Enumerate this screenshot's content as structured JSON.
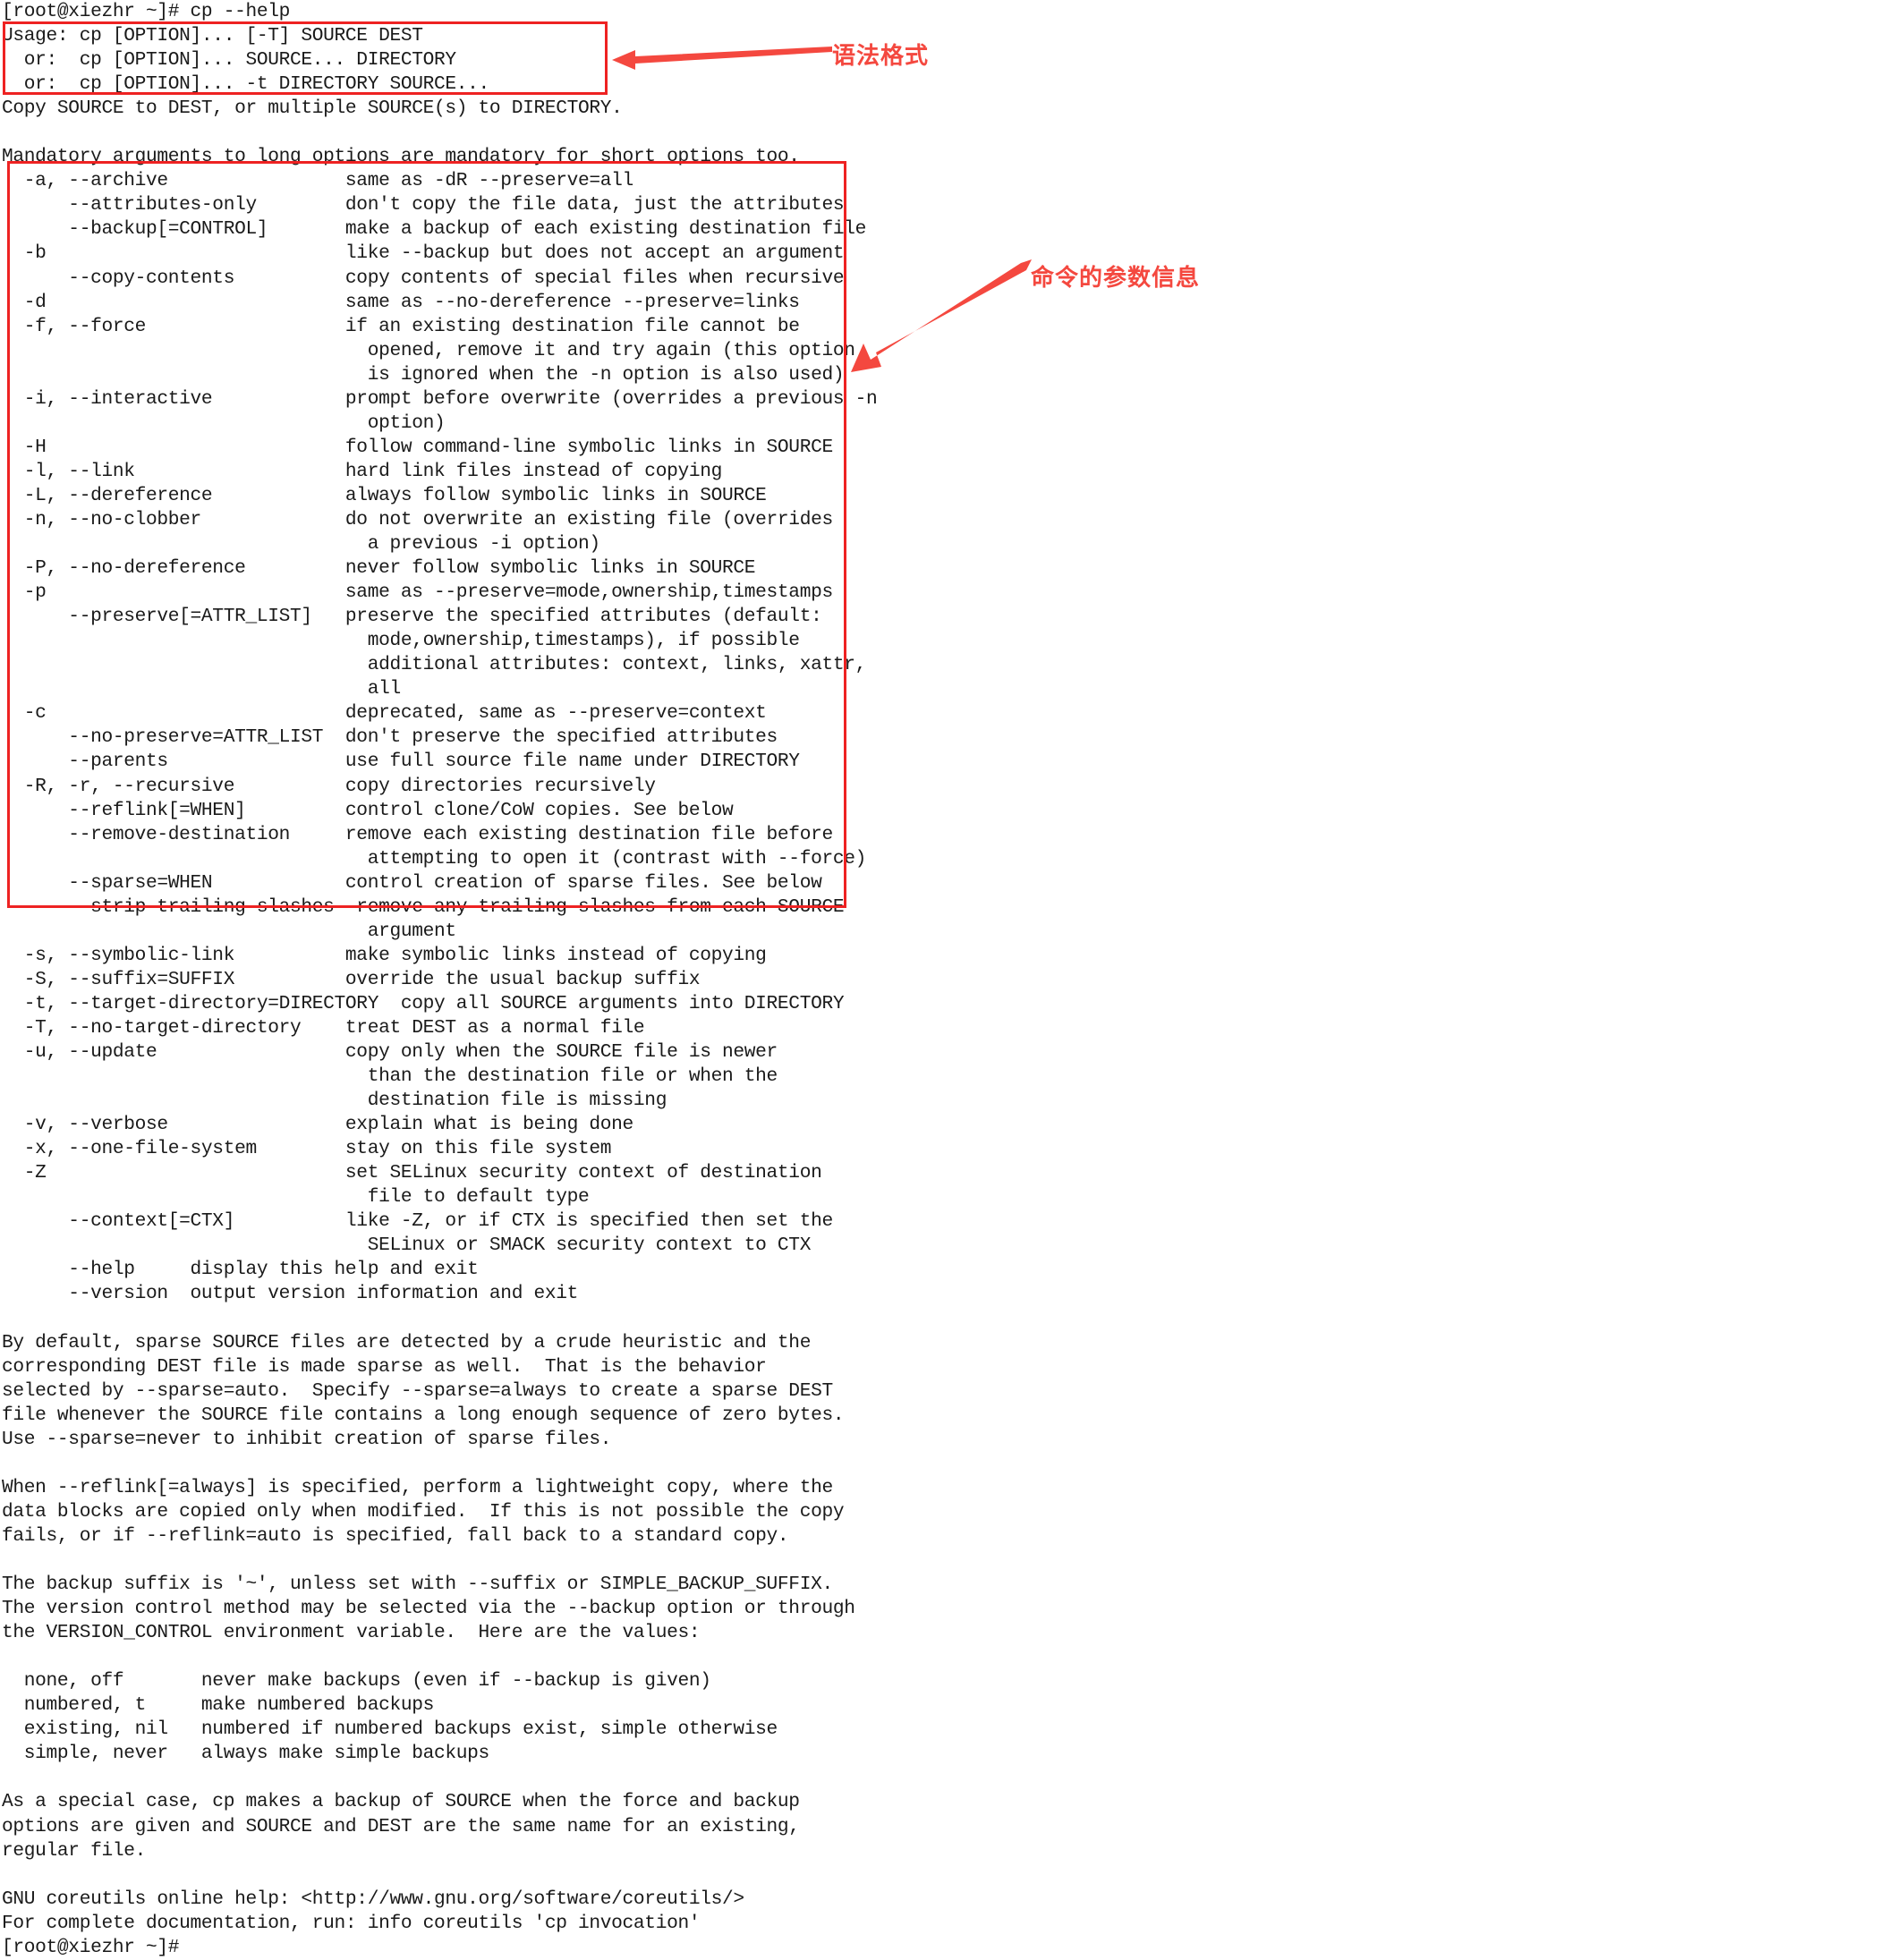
{
  "terminal": {
    "prompt": "[root@xiezhr ~]#",
    "command": "cp --help",
    "lines": [
      "[root@xiezhr ~]# cp --help",
      "Usage: cp [OPTION]... [-T] SOURCE DEST",
      "  or:  cp [OPTION]... SOURCE... DIRECTORY",
      "  or:  cp [OPTION]... -t DIRECTORY SOURCE...",
      "Copy SOURCE to DEST, or multiple SOURCE(s) to DIRECTORY.",
      "",
      "Mandatory arguments to long options are mandatory for short options too.",
      "  -a, --archive                same as -dR --preserve=all",
      "      --attributes-only        don't copy the file data, just the attributes",
      "      --backup[=CONTROL]       make a backup of each existing destination file",
      "  -b                           like --backup but does not accept an argument",
      "      --copy-contents          copy contents of special files when recursive",
      "  -d                           same as --no-dereference --preserve=links",
      "  -f, --force                  if an existing destination file cannot be",
      "                                 opened, remove it and try again (this option",
      "                                 is ignored when the -n option is also used)",
      "  -i, --interactive            prompt before overwrite (overrides a previous -n",
      "                                 option)",
      "  -H                           follow command-line symbolic links in SOURCE",
      "  -l, --link                   hard link files instead of copying",
      "  -L, --dereference            always follow symbolic links in SOURCE",
      "  -n, --no-clobber             do not overwrite an existing file (overrides",
      "                                 a previous -i option)",
      "  -P, --no-dereference         never follow symbolic links in SOURCE",
      "  -p                           same as --preserve=mode,ownership,timestamps",
      "      --preserve[=ATTR_LIST]   preserve the specified attributes (default:",
      "                                 mode,ownership,timestamps), if possible",
      "                                 additional attributes: context, links, xattr,",
      "                                 all",
      "  -c                           deprecated, same as --preserve=context",
      "      --no-preserve=ATTR_LIST  don't preserve the specified attributes",
      "      --parents                use full source file name under DIRECTORY",
      "  -R, -r, --recursive          copy directories recursively",
      "      --reflink[=WHEN]         control clone/CoW copies. See below",
      "      --remove-destination     remove each existing destination file before",
      "                                 attempting to open it (contrast with --force)",
      "      --sparse=WHEN            control creation of sparse files. See below",
      "      --strip-trailing-slashes  remove any trailing slashes from each SOURCE",
      "                                 argument",
      "  -s, --symbolic-link          make symbolic links instead of copying",
      "  -S, --suffix=SUFFIX          override the usual backup suffix",
      "  -t, --target-directory=DIRECTORY  copy all SOURCE arguments into DIRECTORY",
      "  -T, --no-target-directory    treat DEST as a normal file",
      "  -u, --update                 copy only when the SOURCE file is newer",
      "                                 than the destination file or when the",
      "                                 destination file is missing",
      "  -v, --verbose                explain what is being done",
      "  -x, --one-file-system        stay on this file system",
      "  -Z                           set SELinux security context of destination",
      "                                 file to default type",
      "      --context[=CTX]          like -Z, or if CTX is specified then set the",
      "                                 SELinux or SMACK security context to CTX",
      "      --help     display this help and exit",
      "      --version  output version information and exit",
      "",
      "By default, sparse SOURCE files are detected by a crude heuristic and the",
      "corresponding DEST file is made sparse as well.  That is the behavior",
      "selected by --sparse=auto.  Specify --sparse=always to create a sparse DEST",
      "file whenever the SOURCE file contains a long enough sequence of zero bytes.",
      "Use --sparse=never to inhibit creation of sparse files.",
      "",
      "When --reflink[=always] is specified, perform a lightweight copy, where the",
      "data blocks are copied only when modified.  If this is not possible the copy",
      "fails, or if --reflink=auto is specified, fall back to a standard copy.",
      "",
      "The backup suffix is '~', unless set with --suffix or SIMPLE_BACKUP_SUFFIX.",
      "The version control method may be selected via the --backup option or through",
      "the VERSION_CONTROL environment variable.  Here are the values:",
      "",
      "  none, off       never make backups (even if --backup is given)",
      "  numbered, t     make numbered backups",
      "  existing, nil   numbered if numbered backups exist, simple otherwise",
      "  simple, never   always make simple backups",
      "",
      "As a special case, cp makes a backup of SOURCE when the force and backup",
      "options are given and SOURCE and DEST are the same name for an existing,",
      "regular file.",
      "",
      "GNU coreutils online help: <http://www.gnu.org/software/coreutils/>",
      "For complete documentation, run: info coreutils 'cp invocation'",
      "[root@xiezhr ~]#"
    ]
  },
  "annotations": {
    "accent_color": "#ee2222",
    "label_color": "#f4483f",
    "syntax": {
      "label": "语法格式",
      "box_target": "Usage: cp [OPTION]... [-T] SOURCE DEST"
    },
    "params": {
      "label": "命令的参数信息",
      "box_target": "option list block"
    }
  }
}
